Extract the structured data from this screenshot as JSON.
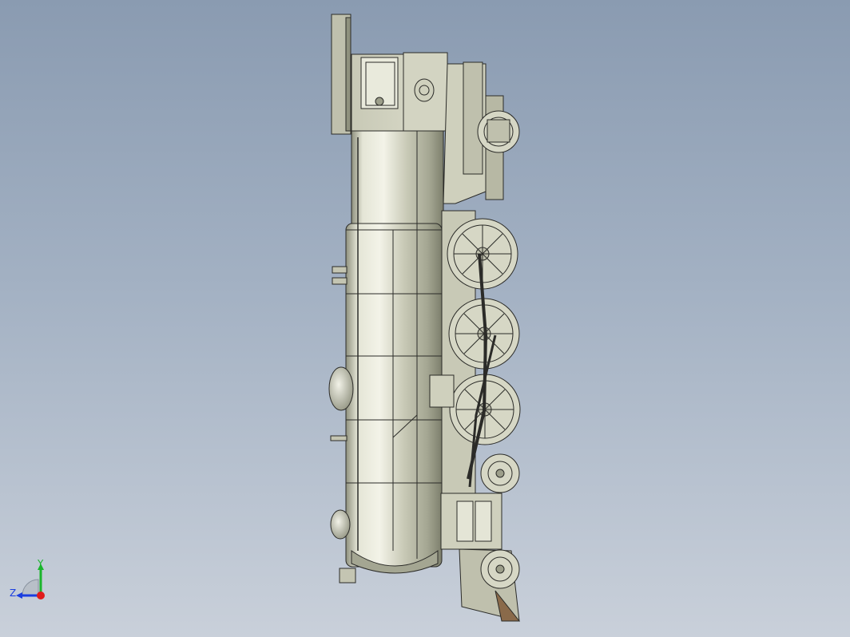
{
  "viewport": {
    "background_top": "#8a9bb1",
    "background_bottom": "#c9d0da"
  },
  "model": {
    "body_color": "#d6d7c5",
    "shade_color": "#9c9e8a",
    "edge_color": "#2b2b28"
  },
  "triad": {
    "y_label": "Y",
    "z_label": "Z",
    "y_color": "#1bb52c",
    "z_color": "#1a3de0",
    "x_color": "#e01b1b"
  }
}
